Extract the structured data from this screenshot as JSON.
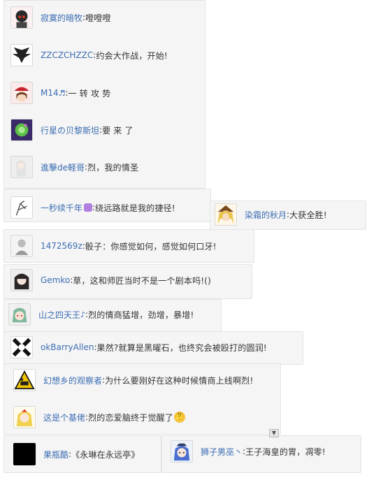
{
  "comments": [
    {
      "name": "寂寞的暗牧",
      "sep": ": ",
      "text": "噔噔噔",
      "avatar": "dark-red-character-avatar"
    },
    {
      "name": "ZZCZCHZZC",
      "sep": ": ",
      "text": "约会大作战，开始!",
      "avatar": "black-wings-avatar"
    },
    {
      "name": "M14",
      "note": "♬",
      "sep": ": ",
      "text": "一 转 攻 势",
      "avatar": "santa-girl-avatar"
    },
    {
      "name": "行星の贝黎斯坦",
      "sep": ": ",
      "text": "要 来 了",
      "avatar": "green-orb-avatar"
    },
    {
      "name": "進擊de軽哥",
      "sep": ": ",
      "text": "烈，我的情圣",
      "avatar": "white-girl-avatar"
    },
    {
      "name": "一秒续千年",
      "sep": ": ",
      "text": "绕远路就是我的捷径!",
      "avatar": "sketch-avatar",
      "badge": "purple-badge-icon"
    },
    {
      "name": "染霜的秋月",
      "sep": ": ",
      "text": "大获全胜!",
      "avatar": "blonde-witch-avatar"
    },
    {
      "name": "1472569z",
      "sep": ": ",
      "text": "骰子：你感觉如何，感觉如何口牙!",
      "avatar": "grey-sketch-avatar"
    },
    {
      "name": "Gemko",
      "sep": ": ",
      "text": "草，这和师匠当时不是一个剧本吗!()",
      "avatar": "dark-hair-girl-avatar"
    },
    {
      "name": "山之四天王",
      "note": "♪",
      "sep": ": ",
      "text": "烈的情商猛增，劲增，暴增!",
      "avatar": "green-hair-avatar"
    },
    {
      "name": "okBarryAllen",
      "sep": ": ",
      "text": "果然?就算是黑曜石，也终究会被殴打的圆润!",
      "avatar": "black-white-avatar"
    },
    {
      "name": "幻想乡的观察者",
      "sep": ": ",
      "text": "为什么要刚好在这种时候情商上线啊烈!",
      "avatar": "warning-sign-avatar"
    },
    {
      "name": "这是个基佬",
      "sep": ": ",
      "text": "烈的恋爱脑终于觉醒了",
      "avatar": "blonde-fairy-avatar",
      "emoji": "thinking-emoji-icon"
    },
    {
      "name": "果瓶酷",
      "sep": ": ",
      "text": "《永琳在永远亭》",
      "avatar": "black-square-avatar"
    },
    {
      "name": "狮子男巫丶",
      "sep": ": ",
      "text": "王子海皇的胃，凋零!",
      "avatar": "blue-hair-girl-avatar"
    }
  ],
  "ui": {
    "scroll_down_glyph": "▼",
    "emoji_glyph": "🤔"
  },
  "colors": {
    "name": "#3b6db3",
    "text": "#333333",
    "panel": "#f5f5f5",
    "border": "#e3e3e3"
  }
}
